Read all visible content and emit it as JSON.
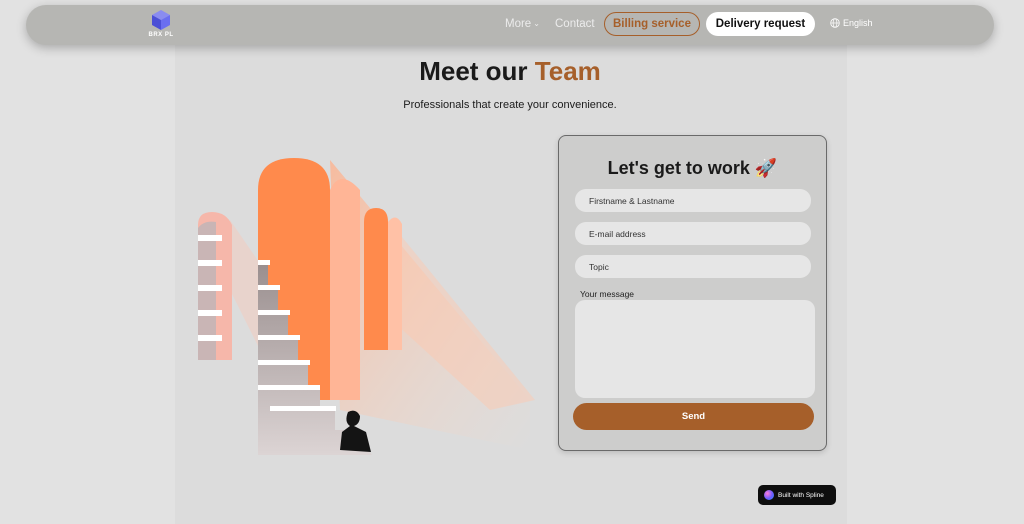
{
  "nav": {
    "logo_text": "BRX PL",
    "more_label": "More",
    "contact_label": "Contact",
    "billing_label": "Billing service",
    "delivery_label": "Delivery request",
    "language_label": "English"
  },
  "hero": {
    "title_part1": "Meet our",
    "title_accent": "Team",
    "subtitle": "Professionals that create your convenience."
  },
  "form": {
    "title": "Let's get to work 🚀",
    "name_placeholder": "Firstname & Lastname",
    "email_placeholder": "E-mail address",
    "topic_placeholder": "Topic",
    "message_label": "Your message",
    "send_label": "Send"
  },
  "badge": {
    "label": "Built with Spline"
  },
  "colors": {
    "accent": "#a65f2a",
    "navbar": "#b6b6b3",
    "card": "#cdcdcc",
    "arch_orange": "#ff8a4c"
  },
  "icons": [
    "cube-logo-icon",
    "chevron-down-icon",
    "globe-icon",
    "spline-logo-icon"
  ]
}
